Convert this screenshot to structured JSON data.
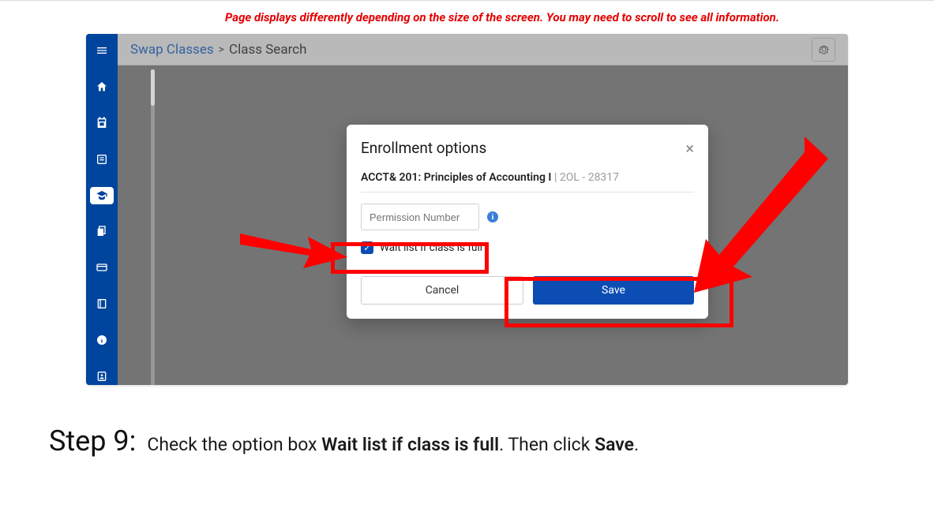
{
  "banner": {
    "text": "Page displays differently depending on the size of the screen. You may need to scroll to see all information."
  },
  "breadcrumb": {
    "parent": "Swap Classes",
    "separator": ">",
    "current": "Class Search"
  },
  "sidebar_items": [
    {
      "name": "menu-icon"
    },
    {
      "name": "home-icon"
    },
    {
      "name": "calendar-icon"
    },
    {
      "name": "list-icon"
    },
    {
      "name": "education-icon",
      "active": true
    },
    {
      "name": "copy-icon"
    },
    {
      "name": "card-icon"
    },
    {
      "name": "book-icon"
    },
    {
      "name": "info-icon"
    },
    {
      "name": "account-icon"
    }
  ],
  "modal": {
    "title": "Enrollment options",
    "course_bold": "ACCT& 201: Principles of Accounting I",
    "course_light": "| 2OL - 28317",
    "permission_placeholder": "Permission Number",
    "waitlist_label": "Wait list if class is full",
    "cancel_label": "Cancel",
    "save_label": "Save"
  },
  "step": {
    "label": "Step 9:",
    "prefix": "Check the option box ",
    "bold1": "Wait list if class is full",
    "mid": ". Then click ",
    "bold2": "Save",
    "suffix": "."
  }
}
